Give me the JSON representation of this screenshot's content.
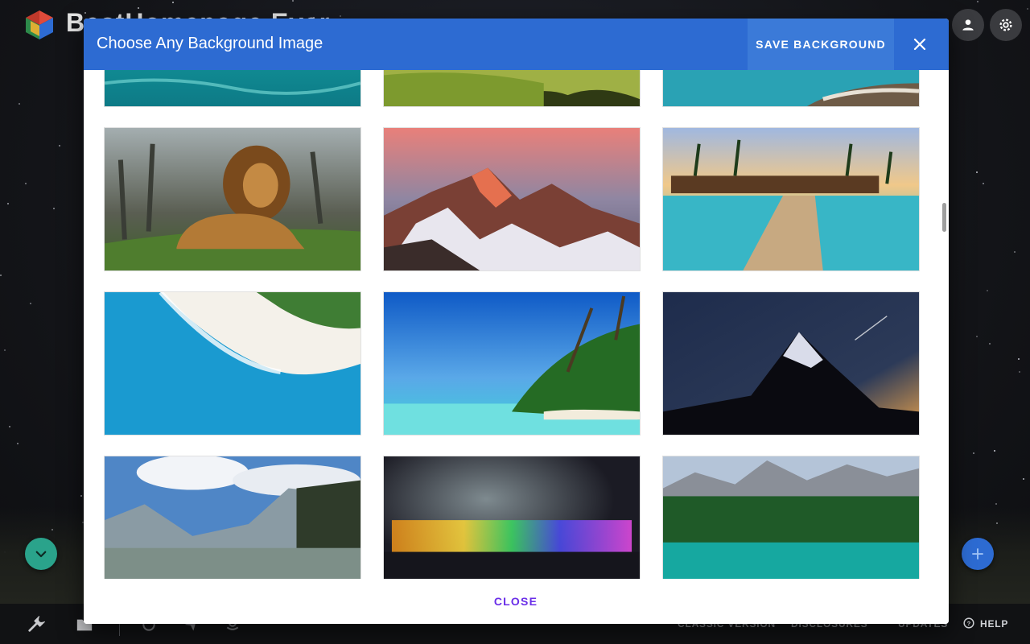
{
  "app": {
    "name": "BestHomepage Ever"
  },
  "modal": {
    "title": "Choose Any Background Image",
    "save_label": "SAVE BACKGROUND",
    "close_label": "CLOSE"
  },
  "thumbnails": [
    {
      "subject": "ocean-water",
      "colors": [
        "#1fa3a0",
        "#0d7a86"
      ]
    },
    {
      "subject": "green-hills",
      "colors": [
        "#8aa33b",
        "#41511c"
      ]
    },
    {
      "subject": "rocky-coast",
      "colors": [
        "#2aa2b4",
        "#6e5b47"
      ]
    },
    {
      "subject": "lion",
      "colors": [
        "#7a8a86",
        "#4f7d2e"
      ]
    },
    {
      "subject": "snowy-peak-sunset",
      "colors": [
        "#d97c78",
        "#6a6b80"
      ]
    },
    {
      "subject": "tropical-pier",
      "colors": [
        "#38b6c6",
        "#f0b86a"
      ]
    },
    {
      "subject": "aerial-beach",
      "colors": [
        "#1a9ad0",
        "#e8e4dc"
      ]
    },
    {
      "subject": "palm-beach",
      "colors": [
        "#1b6fd2",
        "#3fd0da"
      ]
    },
    {
      "subject": "night-mountain",
      "colors": [
        "#1e2c4c",
        "#e8a24c"
      ]
    },
    {
      "subject": "mountain-lake",
      "colors": [
        "#4f86c6",
        "#7d8f88"
      ]
    },
    {
      "subject": "illuminated-waterfall",
      "colors": [
        "#1b1b24",
        "#e04adf"
      ]
    },
    {
      "subject": "alpine-forest-lake",
      "colors": [
        "#2a7d6a",
        "#16a8a0"
      ]
    }
  ],
  "bottom_bar": {
    "links": [
      "CLASSIC VERSION",
      "DISCLOSURES",
      "UPDATES"
    ],
    "help_label": "HELP"
  },
  "colors": {
    "header_blue": "#2d6bd2",
    "close_purple": "#6a2ee8",
    "fab_green": "#2aa38b"
  }
}
